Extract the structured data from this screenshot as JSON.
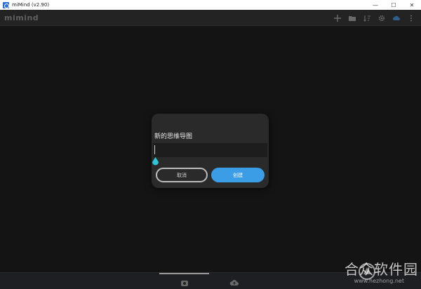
{
  "window": {
    "title": "miMind (v2.90)",
    "minimize": "—",
    "maximize": "☐",
    "close": "✕"
  },
  "toolbar": {
    "logo": "mimind",
    "icons": [
      "add-icon",
      "folder-icon",
      "sort-icon",
      "gear-icon",
      "cloud-icon",
      "more-vertical-icon"
    ]
  },
  "dialog": {
    "title": "新的思维导图",
    "input_value": "",
    "cancel_label": "取消",
    "create_label": "创建"
  },
  "bottombar": {
    "icons": [
      "local-storage-icon",
      "cloud-upload-icon"
    ]
  },
  "watermark": {
    "text": "合众软件园",
    "url": "www.hezhong.net"
  },
  "colors": {
    "accent": "#3b9de6",
    "caret_handle": "#2ec5d8",
    "background": "#141414",
    "toolbar": "#232323",
    "dialog": "#2a2a2a"
  }
}
